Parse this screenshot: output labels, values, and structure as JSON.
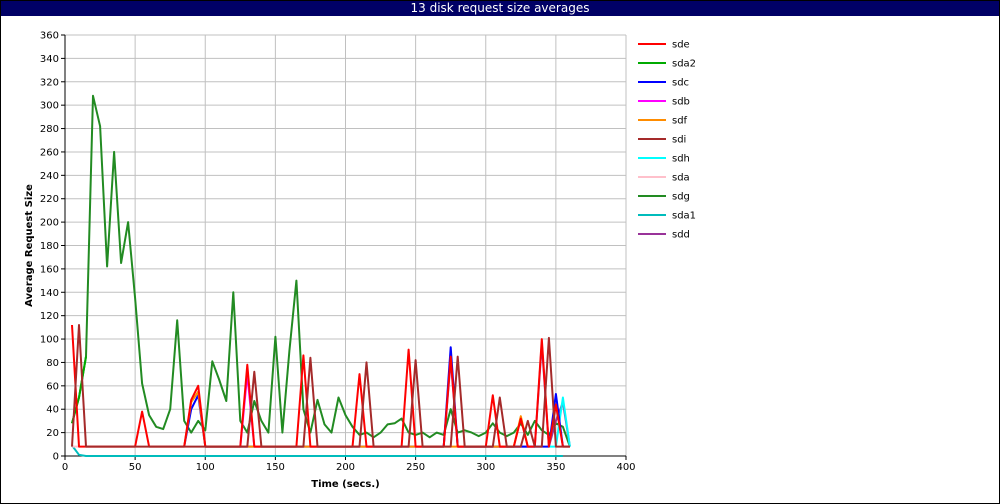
{
  "title": "13 disk request size averages",
  "chart_data": {
    "type": "line",
    "title": "13 disk request size averages",
    "xlabel": "Time (secs.)",
    "ylabel": "Average Request Size",
    "xlim": [
      0,
      400
    ],
    "ylim": [
      0,
      360
    ],
    "xticks": [
      0,
      50,
      100,
      150,
      200,
      250,
      300,
      350,
      400
    ],
    "yticks": [
      0,
      20,
      40,
      60,
      80,
      100,
      120,
      140,
      160,
      180,
      200,
      220,
      240,
      260,
      280,
      300,
      320,
      340,
      360
    ],
    "grid": true,
    "legend_position": "right",
    "series": [
      {
        "name": "sde",
        "color": "#ff0000",
        "x": [
          5,
          10,
          15,
          20,
          25,
          30,
          35,
          40,
          45,
          50,
          55,
          60,
          65,
          70,
          75,
          80,
          85,
          90,
          95,
          100,
          105,
          110,
          115,
          120,
          125,
          130,
          135,
          140,
          145,
          150,
          155,
          160,
          165,
          170,
          175,
          180,
          185,
          190,
          195,
          200,
          205,
          210,
          215,
          220,
          225,
          230,
          235,
          240,
          245,
          250,
          255,
          260,
          265,
          270,
          275,
          280,
          285,
          290,
          295,
          300,
          305,
          310,
          315,
          320,
          325,
          330,
          335,
          340,
          345,
          350,
          355,
          360
        ],
        "y": [
          112,
          8,
          8,
          8,
          8,
          8,
          8,
          8,
          8,
          8,
          38,
          8,
          8,
          8,
          8,
          8,
          8,
          48,
          60,
          8,
          8,
          8,
          8,
          8,
          8,
          78,
          8,
          8,
          8,
          8,
          8,
          8,
          8,
          86,
          8,
          8,
          8,
          8,
          8,
          8,
          8,
          70,
          8,
          8,
          8,
          8,
          8,
          8,
          91,
          8,
          8,
          8,
          8,
          8,
          85,
          8,
          8,
          8,
          8,
          8,
          52,
          8,
          8,
          8,
          32,
          8,
          8,
          100,
          8,
          44,
          8,
          8
        ]
      },
      {
        "name": "sda2",
        "color": "#00aa00",
        "x": [
          5,
          10,
          15
        ],
        "y": [
          28,
          50,
          85
        ]
      },
      {
        "name": "sdc",
        "color": "#0000ff",
        "x": [
          85,
          90,
          95,
          100,
          105,
          270,
          275,
          280,
          345,
          350,
          355
        ],
        "y": [
          8,
          40,
          52,
          8,
          8,
          8,
          93,
          8,
          8,
          53,
          8
        ]
      },
      {
        "name": "sdb",
        "color": "#ff00ff",
        "x": [
          125,
          130,
          135
        ],
        "y": [
          8,
          70,
          8
        ]
      },
      {
        "name": "sdf",
        "color": "#ff8c00",
        "x": [
          85,
          90,
          95,
          100,
          320,
          325,
          330
        ],
        "y": [
          8,
          46,
          55,
          8,
          8,
          34,
          8
        ]
      },
      {
        "name": "sdi",
        "color": "#a52a2a",
        "x": [
          5,
          10,
          15,
          20,
          25,
          30,
          35,
          40,
          45,
          50,
          55,
          60,
          65,
          70,
          75,
          80,
          85,
          90,
          95,
          100,
          105,
          110,
          115,
          120,
          125,
          130,
          135,
          140,
          145,
          150,
          155,
          160,
          165,
          170,
          175,
          180,
          185,
          190,
          195,
          200,
          205,
          210,
          215,
          220,
          225,
          230,
          235,
          240,
          245,
          250,
          255,
          260,
          265,
          270,
          275,
          280,
          285,
          290,
          295,
          300,
          305,
          310,
          315,
          320,
          325,
          330,
          335,
          340,
          345,
          350,
          355,
          360
        ],
        "y": [
          8,
          112,
          8,
          8,
          8,
          8,
          8,
          8,
          8,
          8,
          8,
          8,
          8,
          8,
          8,
          8,
          8,
          8,
          8,
          8,
          8,
          8,
          8,
          8,
          8,
          8,
          72,
          8,
          8,
          8,
          8,
          8,
          8,
          8,
          84,
          8,
          8,
          8,
          8,
          8,
          8,
          8,
          80,
          8,
          8,
          8,
          8,
          8,
          8,
          82,
          8,
          8,
          8,
          8,
          8,
          85,
          8,
          8,
          8,
          8,
          8,
          50,
          8,
          8,
          8,
          30,
          8,
          8,
          101,
          8,
          8,
          8
        ]
      },
      {
        "name": "sdh",
        "color": "#00ffff",
        "x": [
          345,
          350,
          355,
          360
        ],
        "y": [
          8,
          8,
          50,
          8
        ]
      },
      {
        "name": "sda",
        "color": "#ffc0cb",
        "x": [
          5,
          10
        ],
        "y": [
          8,
          8
        ]
      },
      {
        "name": "sdg",
        "color": "#228b22",
        "x": [
          5,
          10,
          15,
          20,
          25,
          30,
          35,
          40,
          45,
          50,
          55,
          60,
          65,
          70,
          75,
          80,
          85,
          90,
          95,
          100,
          105,
          110,
          115,
          120,
          125,
          130,
          135,
          140,
          145,
          150,
          155,
          160,
          165,
          170,
          175,
          180,
          185,
          190,
          195,
          200,
          205,
          210,
          215,
          220,
          225,
          230,
          235,
          240,
          245,
          250,
          255,
          260,
          265,
          270,
          275,
          280,
          285,
          290,
          295,
          300,
          305,
          310,
          315,
          320,
          325,
          330,
          335,
          340,
          345,
          350,
          355,
          360
        ],
        "y": [
          28,
          50,
          85,
          308,
          282,
          162,
          260,
          165,
          200,
          135,
          62,
          35,
          25,
          23,
          40,
          116,
          30,
          20,
          30,
          22,
          81,
          65,
          47,
          140,
          30,
          20,
          47,
          30,
          20,
          102,
          20,
          90,
          150,
          40,
          20,
          48,
          27,
          20,
          50,
          35,
          25,
          18,
          20,
          16,
          20,
          27,
          28,
          32,
          20,
          18,
          20,
          16,
          20,
          18,
          40,
          20,
          22,
          20,
          17,
          20,
          28,
          20,
          17,
          20,
          28,
          18,
          30,
          22,
          18,
          28,
          25,
          8
        ]
      },
      {
        "name": "sda1",
        "color": "#00bcbc",
        "x": [
          5,
          10,
          15,
          20,
          25,
          30,
          35,
          40,
          45,
          50,
          55,
          60,
          65,
          70,
          75,
          80,
          85,
          90,
          95,
          100,
          105,
          110,
          115,
          120,
          125,
          130,
          135,
          140,
          145,
          150,
          155,
          160,
          165,
          170,
          175,
          180,
          185,
          190,
          195,
          200,
          205,
          210,
          215,
          220,
          225,
          230,
          235,
          240,
          245,
          250,
          255,
          260,
          265,
          270,
          275,
          280,
          285,
          290,
          295,
          300,
          305,
          310,
          315,
          320,
          325,
          330,
          335,
          340,
          345,
          350,
          355
        ],
        "y": [
          9,
          1,
          0,
          0,
          0,
          0,
          0,
          0,
          0,
          0,
          0,
          0,
          0,
          0,
          0,
          0,
          0,
          0,
          0,
          0,
          0,
          0,
          0,
          0,
          0,
          0,
          0,
          0,
          0,
          0,
          0,
          0,
          0,
          0,
          0,
          0,
          0,
          0,
          0,
          0,
          0,
          0,
          0,
          0,
          0,
          0,
          0,
          0,
          0,
          0,
          0,
          0,
          0,
          0,
          0,
          0,
          0,
          0,
          0,
          0,
          0,
          0,
          0,
          0,
          0,
          0,
          0,
          0,
          0,
          0,
          0
        ]
      },
      {
        "name": "sdd",
        "color": "#993399",
        "x": [
          270,
          275,
          280,
          335,
          340,
          345,
          350,
          355,
          360
        ],
        "y": [
          8,
          82,
          8,
          8,
          96,
          8,
          30,
          46,
          8
        ]
      }
    ],
    "draw_order": [
      "sda1",
      "sdg",
      "sda2",
      "sdd",
      "sdh",
      "sda",
      "sdc",
      "sdb",
      "sdf",
      "sde",
      "sdi"
    ]
  }
}
